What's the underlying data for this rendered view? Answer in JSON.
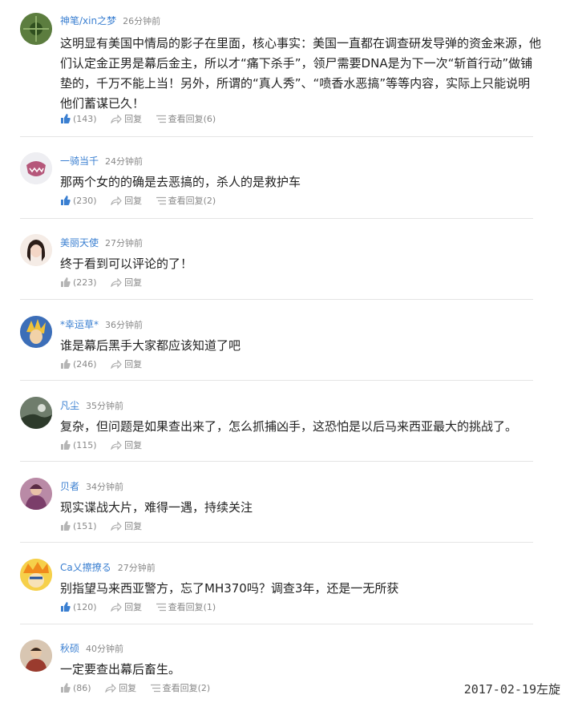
{
  "comments": [
    {
      "user": "神笔/xin之梦",
      "time": "26分钟前",
      "text": "这明显有美国中情局的影子在里面，核心事实：美国一直都在调查研发导弹的资金来源，他们认定金正男是幕后金主，所以才“痛下杀手”，领尸需要DNA是为下一次“斩首行动”做铺垫的，千万不能上当！另外，所谓的“真人秀”、“喷香水恶搞”等等内容，实际上只能说明他们蓄谋已久！",
      "likes": "(143)",
      "reply": "回复",
      "view": "查看回复(6)",
      "liked": true
    },
    {
      "user": "一骑当千",
      "time": "24分钟前",
      "text": "那两个女的的确是去恶搞的，杀人的是救护车",
      "likes": "(230)",
      "reply": "回复",
      "view": "查看回复(2)",
      "liked": true
    },
    {
      "user": "美丽天使",
      "time": "27分钟前",
      "text": "终于看到可以评论的了！",
      "likes": "(223)",
      "reply": "回复",
      "view": null,
      "liked": false
    },
    {
      "user": "*幸运草*",
      "time": "36分钟前",
      "text": "谁是幕后黑手大家都应该知道了吧",
      "likes": "(246)",
      "reply": "回复",
      "view": null,
      "liked": false
    },
    {
      "user": "凡尘",
      "time": "35分钟前",
      "text": "复杂，但问题是如果查出来了，怎么抓捕凶手，这恐怕是以后马来西亚最大的挑战了。",
      "likes": "(115)",
      "reply": "回复",
      "view": null,
      "liked": false
    },
    {
      "user": "贝者",
      "time": "34分钟前",
      "text": "现实谍战大片，难得一遇，持续关注",
      "likes": "(151)",
      "reply": "回复",
      "view": null,
      "liked": false
    },
    {
      "user": "Ca乂擦撩る",
      "time": "27分钟前",
      "text": "别指望马来西亚警方，忘了MH370吗？调查3年，还是一无所获",
      "likes": "(120)",
      "reply": "回复",
      "view": "查看回复(1)",
      "liked": true
    },
    {
      "user": "秋硕",
      "time": "40分钟前",
      "text": "一定要查出幕后畜生。",
      "likes": "(86)",
      "reply": "回复",
      "view": "查看回复(2)",
      "liked": false
    }
  ],
  "footer": "2017-02-19左旋",
  "colors": {
    "accent": "#3a7fd1",
    "muted": "#888888",
    "liked": "#3a7fd1"
  }
}
